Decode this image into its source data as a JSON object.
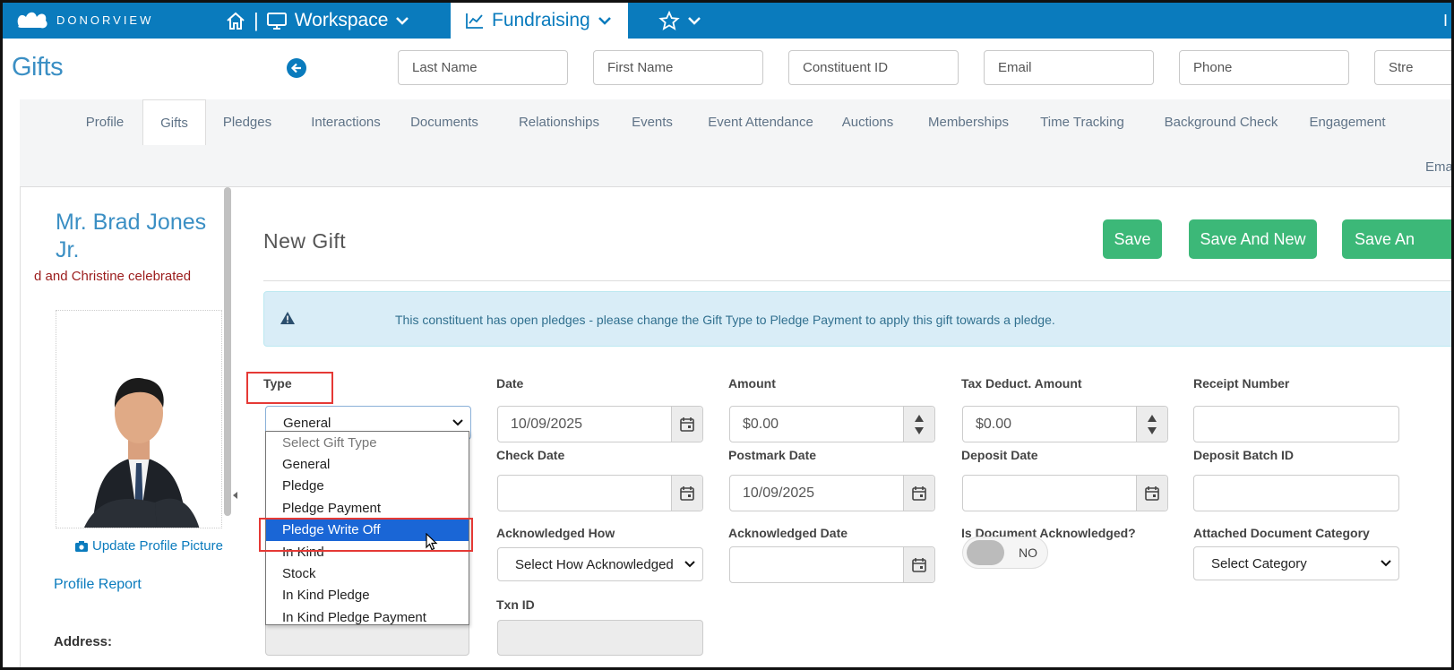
{
  "topnav": {
    "logo_text": "DONORVIEW",
    "workspace_label": "Workspace",
    "fundraising_label": "Fundraising",
    "partial_right": "I"
  },
  "page_title": "Gifts",
  "search": {
    "last_name": "Last Name",
    "first_name": "First Name",
    "constituent_id": "Constituent ID",
    "email": "Email",
    "phone": "Phone",
    "street": "Stre"
  },
  "tabs": [
    "Profile",
    "Gifts",
    "Pledges",
    "Interactions",
    "Documents",
    "Relationships",
    "Events",
    "Event Attendance",
    "Auctions",
    "Memberships",
    "Time Tracking",
    "Background Check",
    "Engagement"
  ],
  "tabs_second_row": "Ema",
  "active_tab": "Gifts",
  "sidebar": {
    "name": "Mr. Brad Jones Jr.",
    "note": "d and Christine celebrated",
    "update_picture": "Update Profile Picture",
    "profile_report": "Profile Report",
    "address_label": "Address:"
  },
  "form": {
    "heading": "New Gift",
    "buttons": {
      "save": "Save",
      "save_and_new": "Save And New",
      "save_and": "Save An"
    },
    "alert": "This constituent has open pledges - please change the Gift Type to Pledge Payment to apply this gift towards a pledge.",
    "labels": {
      "type": "Type",
      "date": "Date",
      "amount": "Amount",
      "tax_deduct": "Tax Deduct. Amount",
      "receipt_number": "Receipt Number",
      "check_date": "Check Date",
      "postmark_date": "Postmark Date",
      "deposit_date": "Deposit Date",
      "deposit_batch": "Deposit Batch ID",
      "ack_how": "Acknowledged How",
      "ack_date": "Acknowledged Date",
      "doc_ack": "Is Document Acknowledged?",
      "doc_category": "Attached Document Category",
      "txn_id": "Txn ID"
    },
    "values": {
      "type": "General",
      "date": "10/09/2025",
      "amount": "$0.00",
      "tax_deduct": "$0.00",
      "postmark_date": "10/09/2025",
      "ack_how": "Select How Acknowledged",
      "doc_ack_toggle": "NO",
      "doc_category": "Select Category"
    },
    "type_options": [
      "Select Gift Type",
      "General",
      "Pledge",
      "Pledge Payment",
      "Pledge Write Off",
      "In Kind",
      "Stock",
      "In Kind Pledge",
      "In Kind Pledge Payment"
    ],
    "highlighted_option": "Pledge Write Off"
  },
  "colors": {
    "brand": "#0a7bbd",
    "save_button": "#3cb878",
    "highlight": "#1a66d6",
    "annotation": "#e53935"
  }
}
